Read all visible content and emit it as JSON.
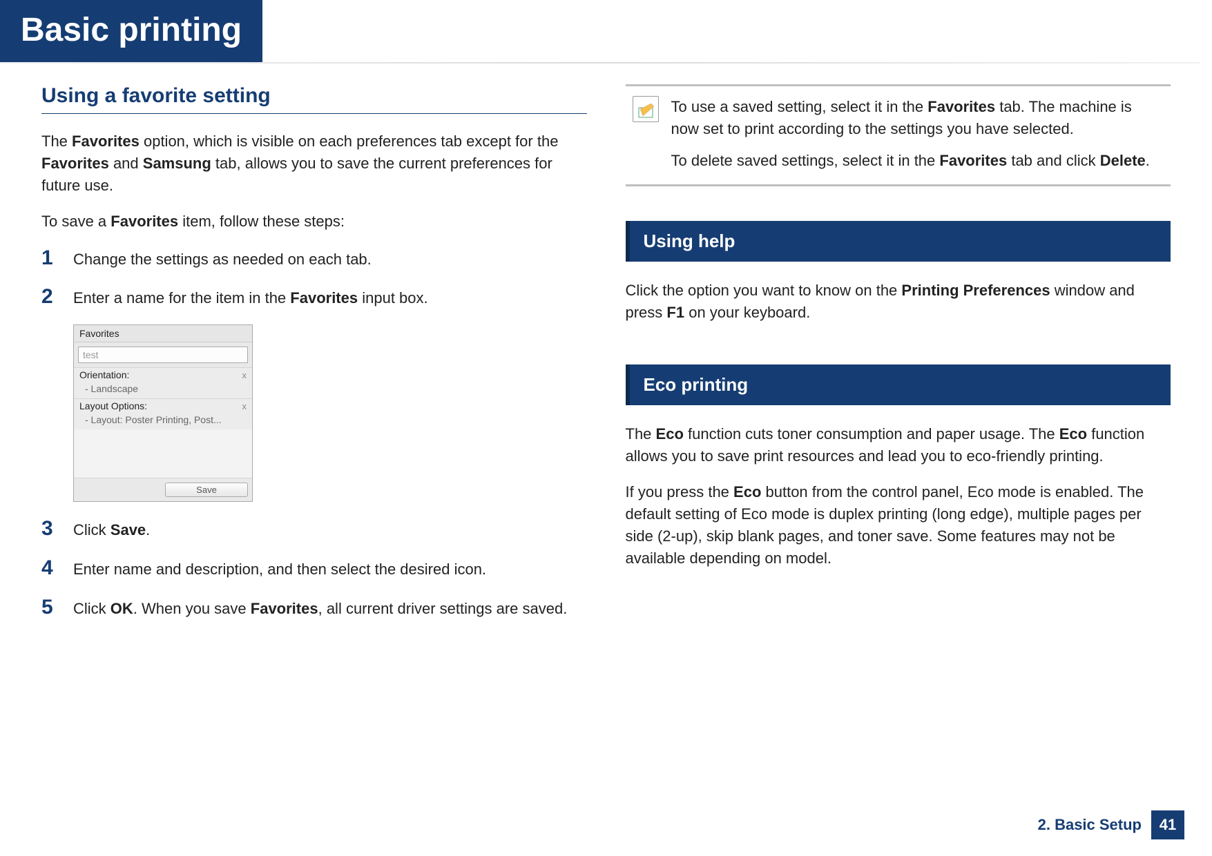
{
  "header": {
    "title": "Basic printing"
  },
  "left": {
    "subtitle": "Using a favorite setting",
    "intro": {
      "pre": "The ",
      "b1": "Favorites",
      "mid1": " option, which is visible on each preferences tab except for the ",
      "b2": "Favorites",
      "mid2": " and ",
      "b3": "Samsung",
      "post": " tab, allows you to save the current preferences for future use."
    },
    "intro2": {
      "pre": "To save a ",
      "b1": "Favorites",
      "post": " item, follow these steps:"
    },
    "steps": {
      "n1": "1",
      "s1": "Change the settings as needed on each tab.",
      "n2": "2",
      "s2_pre": "Enter a name for the item in the ",
      "s2_b": "Favorites",
      "s2_post": " input box.",
      "n3": "3",
      "s3_pre": "Click ",
      "s3_b": "Save",
      "s3_post": ".",
      "n4": "4",
      "s4": "Enter name and description, and then select the desired icon.",
      "n5": "5",
      "s5_pre": "Click ",
      "s5_b1": "OK",
      "s5_mid": ". When you save ",
      "s5_b2": "Favorites",
      "s5_post": ", all current driver settings are saved."
    },
    "fav": {
      "panel_label": "Favorites",
      "input_value": "test",
      "row1_label": "Orientation:",
      "row1_sub": "- Landscape",
      "row2_label": "Layout Options:",
      "row2_sub": "- Layout: Poster Printing, Post...",
      "close_x": "x",
      "save_btn": "Save"
    }
  },
  "right": {
    "note": {
      "p1_pre": "To use a saved setting, select it in the ",
      "p1_b": "Favorites",
      "p1_post": " tab. The machine is now set to print according to the settings you have selected.",
      "p2_pre": "To delete saved settings, select it in the ",
      "p2_b1": "Favorites",
      "p2_mid": " tab and click ",
      "p2_b2": "Delete",
      "p2_post": "."
    },
    "help": {
      "title": "Using help",
      "body_pre": "Click the option you want to know on the ",
      "body_b1": "Printing Preferences",
      "body_mid": " window and press ",
      "body_b2": "F1",
      "body_post": " on your keyboard."
    },
    "eco": {
      "title": "Eco printing",
      "p1_pre": "The ",
      "p1_b1": "Eco",
      "p1_mid": " function cuts toner consumption and paper usage. The ",
      "p1_b2": "Eco",
      "p1_post": " function allows you to save print resources and lead you to eco-friendly printing.",
      "p2_pre": "If you press the ",
      "p2_b": "Eco",
      "p2_post": " button from the control panel, Eco mode is enabled. The default setting of Eco mode is duplex printing (long edge), multiple pages per side (2-up), skip blank pages, and toner save. Some features may not be available depending on model."
    }
  },
  "footer": {
    "chapter": "2. Basic Setup",
    "page": "41"
  }
}
